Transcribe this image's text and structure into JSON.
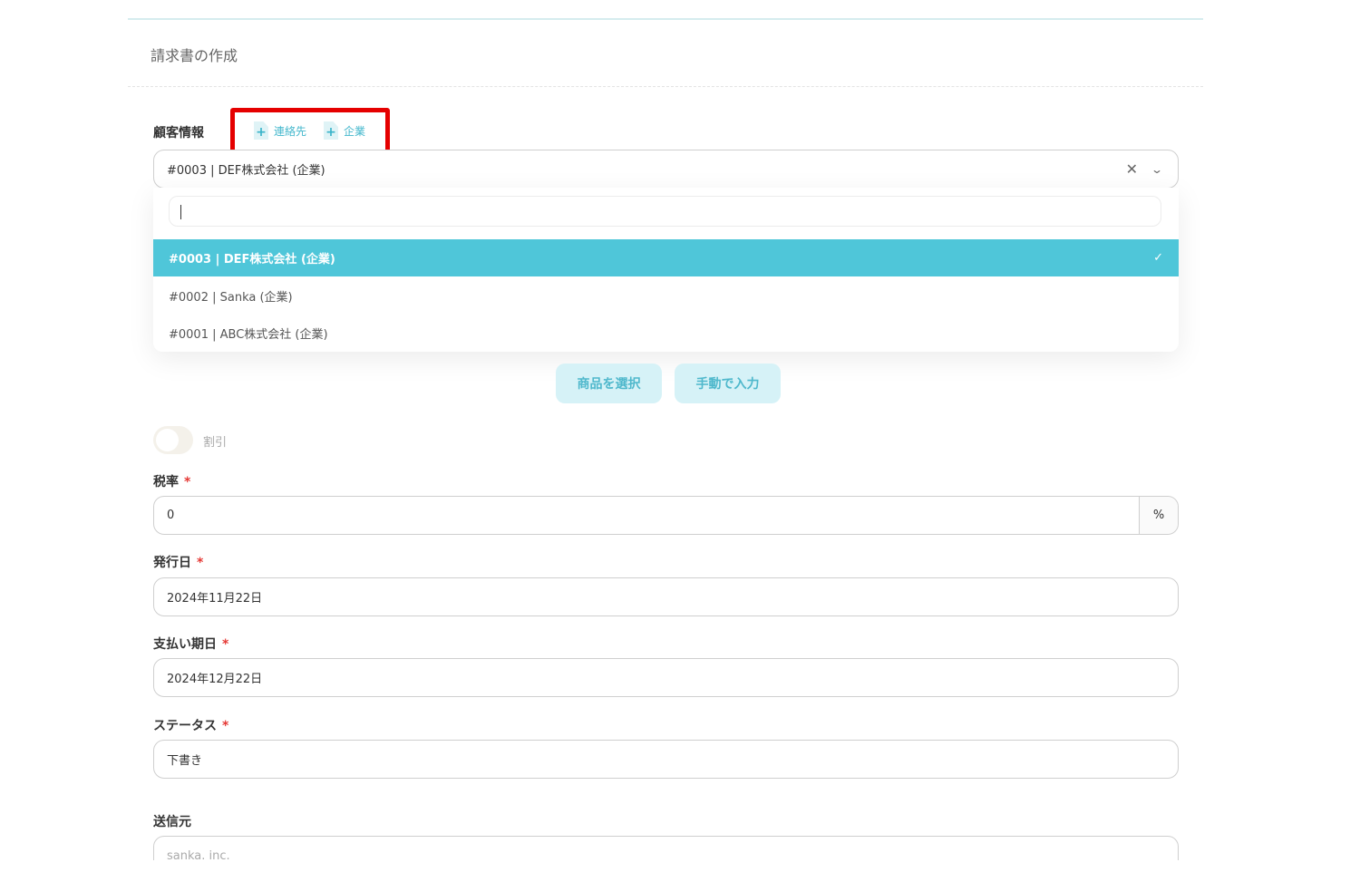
{
  "page": {
    "title": "請求書の作成"
  },
  "customer": {
    "label": "顧客情報",
    "add_contact": "連絡先",
    "add_company": "企業",
    "selected": "#0003 | DEF株式会社 (企業)",
    "search_value": "",
    "options": [
      {
        "label": "#0003 | DEF株式会社 (企業)",
        "selected": true
      },
      {
        "label": "#0002 | Sanka (企業)",
        "selected": false
      },
      {
        "label": "#0001 | ABC株式会社 (企業)",
        "selected": false
      }
    ]
  },
  "items": {
    "select_product": "商品を選択",
    "manual_input": "手動で入力"
  },
  "discount": {
    "label": "割引",
    "enabled": false
  },
  "tax": {
    "label": "税率",
    "required": "*",
    "value": "0",
    "unit": "%"
  },
  "issue_date": {
    "label": "発行日",
    "required": "*",
    "value": "2024年11月22日"
  },
  "due_date": {
    "label": "支払い期日",
    "required": "*",
    "value": "2024年12月22日"
  },
  "status": {
    "label": "ステータス",
    "required": "*",
    "value": "下書き"
  },
  "sender": {
    "label": "送信元",
    "placeholder": "sanka. inc."
  },
  "colors": {
    "accent": "#4fc6d9",
    "highlight": "#e50000"
  }
}
